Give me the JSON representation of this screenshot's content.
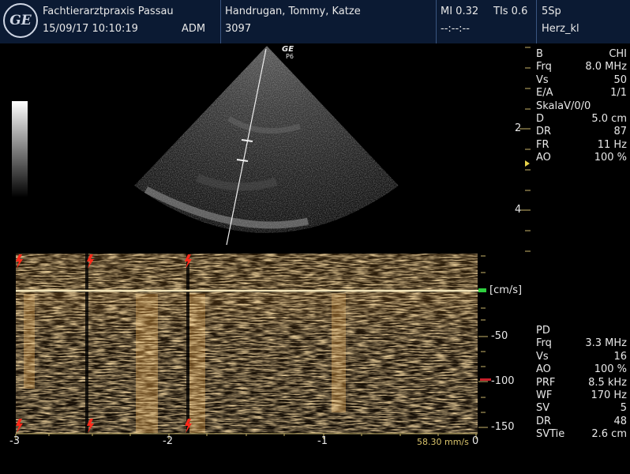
{
  "header": {
    "logo_text": "GE",
    "clinic": "Fachtierarztpraxis Passau",
    "datetime": "15/09/17 10:10:19",
    "operator": "ADM",
    "patient": "Handrugan, Tommy, Katze",
    "patient_id": "3097",
    "mi": "MI 0.32",
    "tis": "TIs 0.6",
    "mi_sub": "--:--:--",
    "probe": "5Sp",
    "preset": "Herz_kl"
  },
  "b_mode": {
    "probe_marker": "GE",
    "probe_sub": "P6",
    "depth_labels": [
      "2",
      "4"
    ],
    "params": [
      {
        "k": "B",
        "v": "CHI"
      },
      {
        "k": "Frq",
        "v": "8.0 MHz"
      },
      {
        "k": "Vs",
        "v": "50"
      },
      {
        "k": "E/A",
        "v": "1/1"
      },
      {
        "k": "SkalaV/0/0",
        "v": ""
      },
      {
        "k": "D",
        "v": "5.0 cm"
      },
      {
        "k": "DR",
        "v": "87"
      },
      {
        "k": "FR",
        "v": "11 Hz"
      },
      {
        "k": "AO",
        "v": "100 %"
      }
    ]
  },
  "doppler": {
    "unit": "[cm/s]",
    "velocity_labels": [
      "-50",
      "-100",
      "-150"
    ],
    "time_labels": [
      "-3",
      "-2",
      "-1",
      "0"
    ],
    "sweep_speed": "58.30 mm/s",
    "params": [
      {
        "k": "PD",
        "v": ""
      },
      {
        "k": "Frq",
        "v": "3.3 MHz"
      },
      {
        "k": "Vs",
        "v": "16"
      },
      {
        "k": "AO",
        "v": "100 %"
      },
      {
        "k": "PRF",
        "v": "8.5 kHz"
      },
      {
        "k": "WF",
        "v": "170 Hz"
      },
      {
        "k": "SV",
        "v": "5"
      },
      {
        "k": "DR",
        "v": "48"
      },
      {
        "k": "SVTie",
        "v": "2.6 cm"
      }
    ]
  },
  "colors": {
    "header_bg": "#0b1a33",
    "doppler_tint": "#c89a48",
    "baseline": "#f2e4b8",
    "scale_tick": "#c7b56a",
    "ecg_trigger": "#ff2a1a",
    "baseline_marker": "#2fcf3f",
    "prf_marker": "#c8202a"
  }
}
